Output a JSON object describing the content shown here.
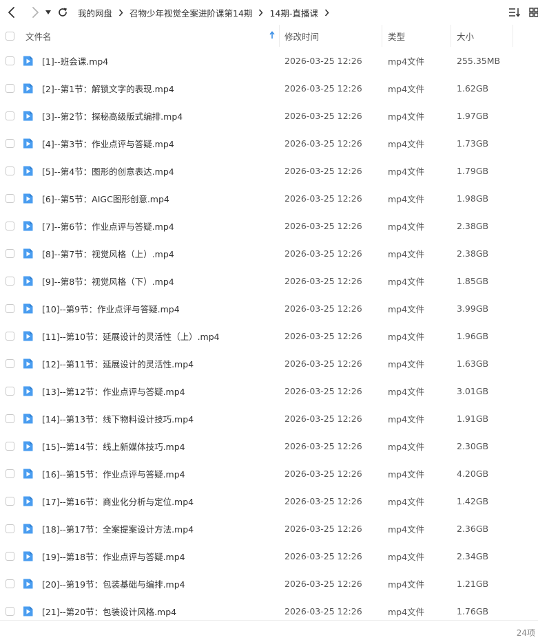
{
  "breadcrumb": {
    "items": [
      "我的网盘",
      "召物少年视觉全案进阶课第14期",
      "14期-直播课"
    ]
  },
  "columns": {
    "name": "文件名",
    "mtime": "修改时间",
    "type": "类型",
    "size": "大小"
  },
  "icons": {
    "back": "back-arrow-icon",
    "forward": "forward-arrow-icon",
    "history": "dropdown-caret-icon",
    "refresh": "refresh-icon",
    "sort": "sort-list-icon",
    "view": "grid-view-icon",
    "video": "video-file-icon"
  },
  "colors": {
    "video_icon": "#4a9df0",
    "sort_arrow": "#3a8ee6"
  },
  "files": [
    {
      "name": "[1]--班会课.mp4",
      "mtime": "2026-03-25 12:26",
      "type": "mp4文件",
      "size": "255.35MB"
    },
    {
      "name": "[2]--第1节：解锁文字的表现.mp4",
      "mtime": "2026-03-25 12:26",
      "type": "mp4文件",
      "size": "1.62GB"
    },
    {
      "name": "[3]--第2节：探秘高级版式编排.mp4",
      "mtime": "2026-03-25 12:26",
      "type": "mp4文件",
      "size": "1.97GB"
    },
    {
      "name": "[4]--第3节：作业点评与答疑.mp4",
      "mtime": "2026-03-25 12:26",
      "type": "mp4文件",
      "size": "1.73GB"
    },
    {
      "name": "[5]--第4节：图形的创意表达.mp4",
      "mtime": "2026-03-25 12:26",
      "type": "mp4文件",
      "size": "1.79GB"
    },
    {
      "name": "[6]--第5节：AIGC图形创意.mp4",
      "mtime": "2026-03-25 12:26",
      "type": "mp4文件",
      "size": "1.98GB"
    },
    {
      "name": "[7]--第6节：作业点评与答疑.mp4",
      "mtime": "2026-03-25 12:26",
      "type": "mp4文件",
      "size": "2.38GB"
    },
    {
      "name": "[8]--第7节：视觉风格（上）.mp4",
      "mtime": "2026-03-25 12:26",
      "type": "mp4文件",
      "size": "2.38GB"
    },
    {
      "name": "[9]--第8节：视觉风格（下）.mp4",
      "mtime": "2026-03-25 12:26",
      "type": "mp4文件",
      "size": "1.85GB"
    },
    {
      "name": "[10]--第9节：作业点评与答疑.mp4",
      "mtime": "2026-03-25 12:26",
      "type": "mp4文件",
      "size": "3.99GB"
    },
    {
      "name": "[11]--第10节：延展设计的灵活性（上）.mp4",
      "mtime": "2026-03-25 12:26",
      "type": "mp4文件",
      "size": "1.96GB"
    },
    {
      "name": "[12]--第11节：延展设计的灵活性.mp4",
      "mtime": "2026-03-25 12:26",
      "type": "mp4文件",
      "size": "1.63GB"
    },
    {
      "name": "[13]--第12节：作业点评与答疑.mp4",
      "mtime": "2026-03-25 12:26",
      "type": "mp4文件",
      "size": "3.01GB"
    },
    {
      "name": "[14]--第13节：线下物料设计技巧.mp4",
      "mtime": "2026-03-25 12:26",
      "type": "mp4文件",
      "size": "1.91GB"
    },
    {
      "name": "[15]--第14节：线上新媒体技巧.mp4",
      "mtime": "2026-03-25 12:26",
      "type": "mp4文件",
      "size": "2.30GB"
    },
    {
      "name": "[16]--第15节：作业点评与答疑.mp4",
      "mtime": "2026-03-25 12:26",
      "type": "mp4文件",
      "size": "4.20GB"
    },
    {
      "name": "[17]--第16节：商业化分析与定位.mp4",
      "mtime": "2026-03-25 12:26",
      "type": "mp4文件",
      "size": "1.42GB"
    },
    {
      "name": "[18]--第17节：全案提案设计方法.mp4",
      "mtime": "2026-03-25 12:26",
      "type": "mp4文件",
      "size": "2.36GB"
    },
    {
      "name": "[19]--第18节：作业点评与答疑.mp4",
      "mtime": "2026-03-25 12:26",
      "type": "mp4文件",
      "size": "2.34GB"
    },
    {
      "name": "[20]--第19节：包装基础与编排.mp4",
      "mtime": "2026-03-25 12:26",
      "type": "mp4文件",
      "size": "1.21GB"
    },
    {
      "name": "[21]--第20节：包装设计风格.mp4",
      "mtime": "2026-03-25 12:26",
      "type": "mp4文件",
      "size": "1.76GB"
    }
  ],
  "footer": {
    "count": "24项"
  }
}
